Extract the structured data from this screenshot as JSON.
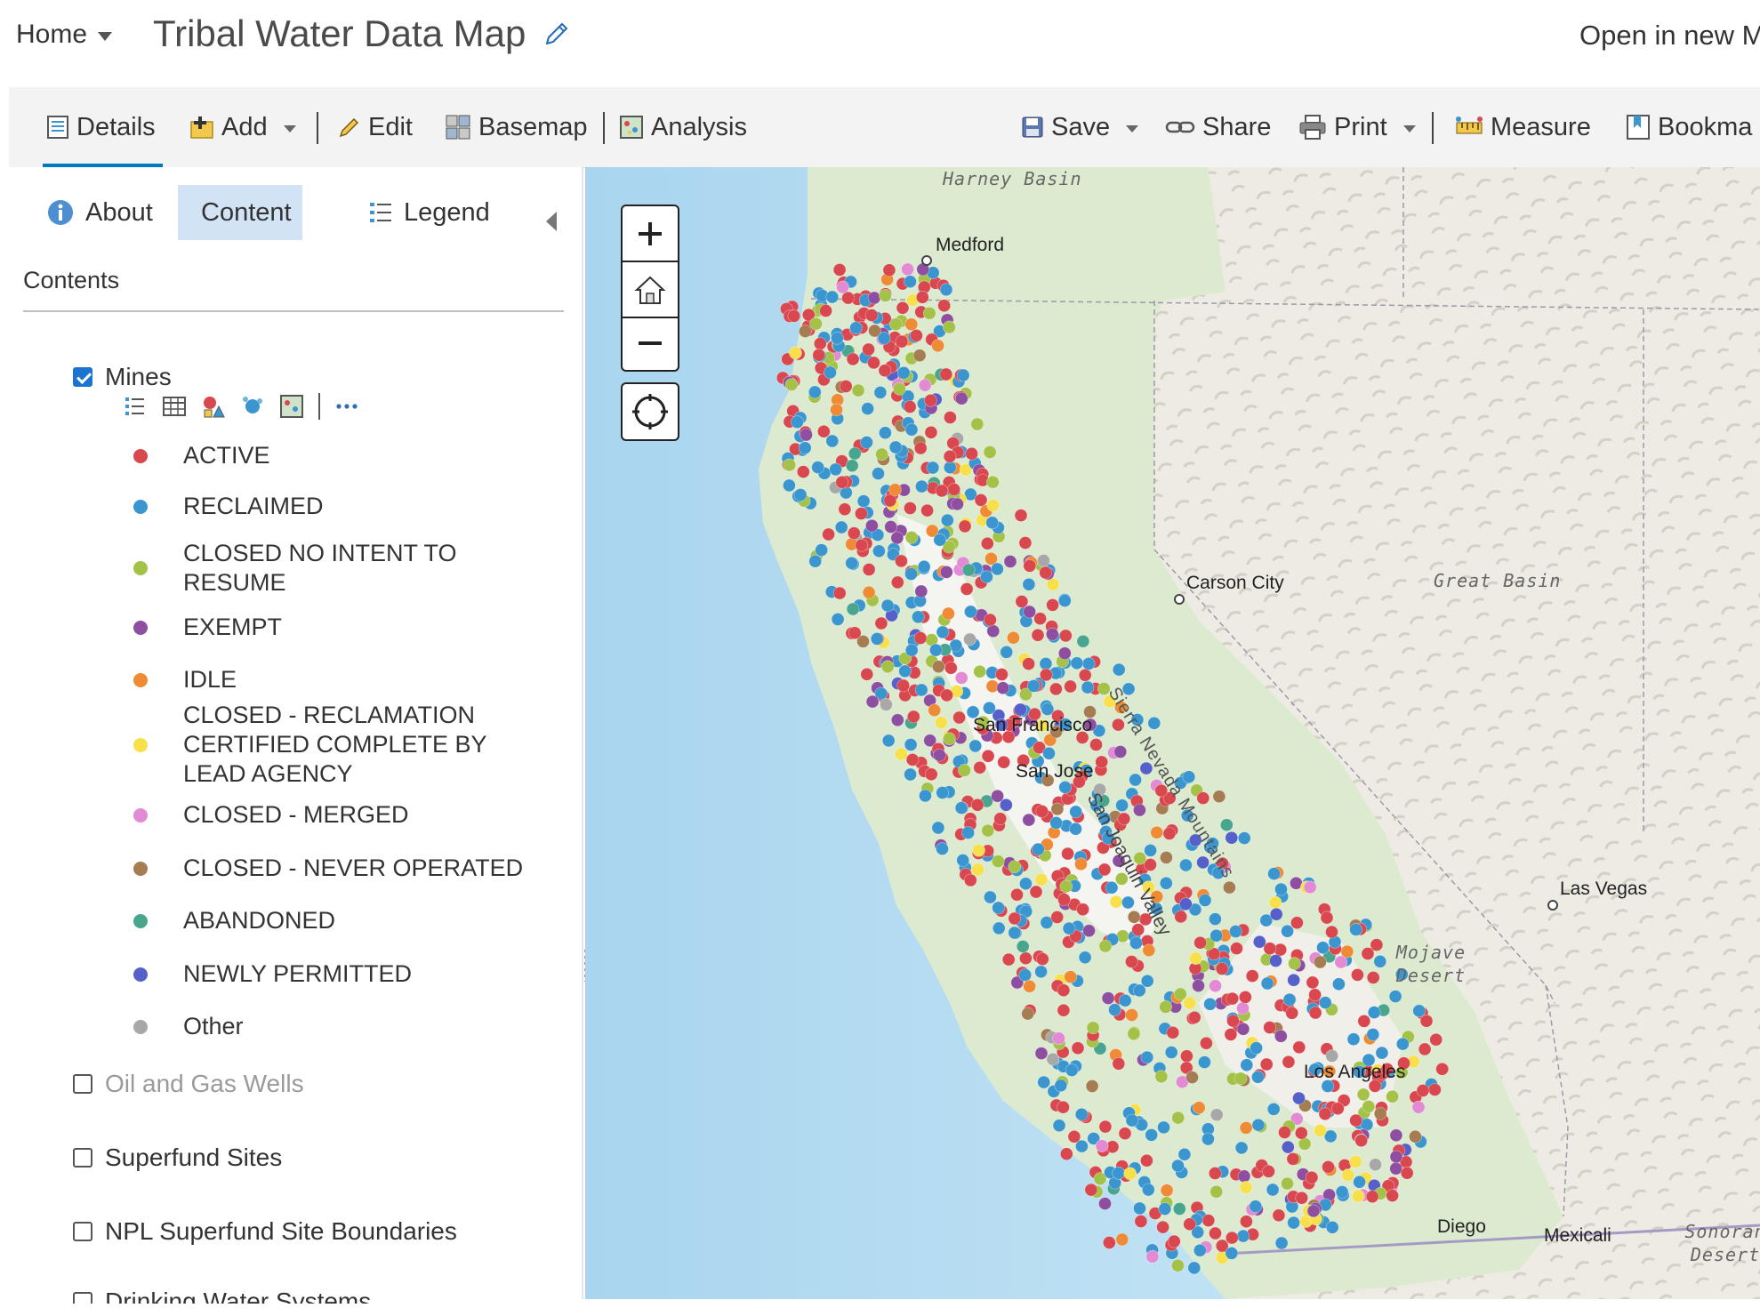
{
  "header": {
    "home_label": "Home",
    "map_title": "Tribal Water Data Map",
    "open_new": "Open in new M"
  },
  "toolbar": {
    "details": "Details",
    "add": "Add",
    "edit": "Edit",
    "basemap": "Basemap",
    "analysis": "Analysis",
    "save": "Save",
    "share": "Share",
    "print": "Print",
    "measure": "Measure",
    "bookmarks": "Bookma"
  },
  "panel": {
    "tabs": {
      "about": "About",
      "content": "Content",
      "legend": "Legend"
    },
    "contents_heading": "Contents",
    "layers": [
      {
        "name": "Mines",
        "checked": true
      },
      {
        "name": "Oil and Gas Wells",
        "checked": false
      },
      {
        "name": "Superfund Sites",
        "checked": false
      },
      {
        "name": "NPL Superfund Site Boundaries",
        "checked": false
      },
      {
        "name": "Drinking Water Systems",
        "checked": false
      }
    ],
    "mines_legend": [
      {
        "label": "ACTIVE",
        "color": "#d9474f"
      },
      {
        "label": "RECLAIMED",
        "color": "#3b96d0"
      },
      {
        "label": "CLOSED NO INTENT TO RESUME",
        "color": "#a3c247"
      },
      {
        "label": "EXEMPT",
        "color": "#8e4fa1"
      },
      {
        "label": "IDLE",
        "color": "#ef8a35"
      },
      {
        "label": "CLOSED - RECLAMATION CERTIFIED COMPLETE BY LEAD AGENCY",
        "color": "#f7e04c"
      },
      {
        "label": "CLOSED - MERGED",
        "color": "#e28ad4"
      },
      {
        "label": "CLOSED - NEVER OPERATED",
        "color": "#a67c52"
      },
      {
        "label": "ABANDONED",
        "color": "#4aa58f"
      },
      {
        "label": "NEWLY PERMITTED",
        "color": "#5560c8"
      },
      {
        "label": "Other",
        "color": "#a8a8a8"
      }
    ]
  },
  "map": {
    "labels": {
      "harney": "Harney Basin",
      "medford": "Medford",
      "carson": "Carson City",
      "great_basin": "Great Basin",
      "sierra": "Sierra Nevada Mountains",
      "sf": "San Francisco",
      "san_jose": "San Jose",
      "sj_valley": "San Joaquin Valley",
      "las_vegas": "Las Vegas",
      "mojave": "Mojave Desert",
      "la": "Los Angeles",
      "san_diego": "Diego",
      "mexicali": "Mexicali",
      "sonoran": "Sonoran Desert"
    }
  }
}
